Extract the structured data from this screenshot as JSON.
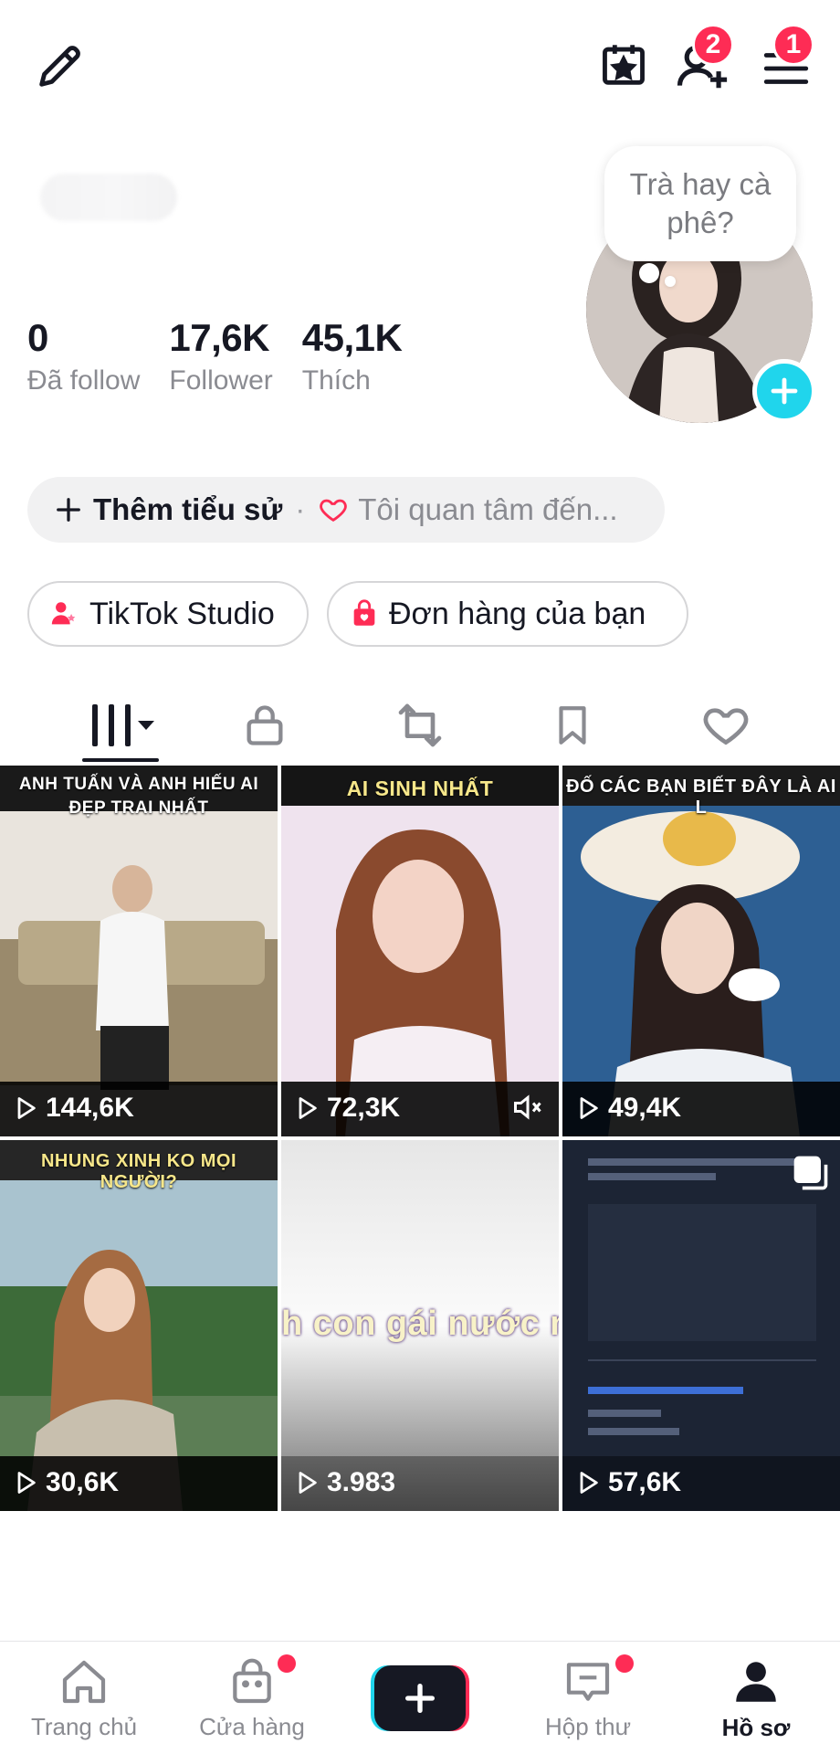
{
  "top_bar": {
    "edit_icon": "pencil-icon",
    "calendar_icon": "calendar-star-icon",
    "add_friend_icon": "add-user-icon",
    "add_friend_badge": "2",
    "menu_icon": "hamburger-menu-icon",
    "menu_badge": "1"
  },
  "profile": {
    "note_bubble": "Trà hay cà phê?",
    "stats": [
      {
        "value": "0",
        "label": "Đã follow"
      },
      {
        "value": "17,6K",
        "label": "Follower"
      },
      {
        "value": "45,1K",
        "label": "Thích"
      }
    ],
    "bio": {
      "add_label": "Thêm tiểu sử",
      "separator": "·",
      "interest_placeholder": "Tôi quan tâm đến..."
    },
    "buttons": {
      "studio": "TikTok Studio",
      "orders": "Đơn hàng của bạn"
    }
  },
  "tabs": [
    {
      "icon": "grid-icon",
      "active": true
    },
    {
      "icon": "lock-icon",
      "active": false
    },
    {
      "icon": "repost-icon",
      "active": false
    },
    {
      "icon": "bookmark-icon",
      "active": false
    },
    {
      "icon": "heart-icon",
      "active": false
    }
  ],
  "videos": [
    {
      "caption": "ANH TUẤN VÀ ANH HIẾU AI ĐẸP TRAI NHẤT",
      "views": "144,6K",
      "muted": false
    },
    {
      "caption": "AI SINH NHẤT",
      "views": "72,3K",
      "muted": true
    },
    {
      "caption": "ĐỐ CÁC BẠN BIẾT ĐÂY LÀ AI L",
      "views": "49,4K",
      "muted": false
    },
    {
      "caption": "NHUNG XINH KO MỌI NGƯỜI?",
      "views": "30,6K",
      "muted": false
    },
    {
      "caption": "h con gái nước n",
      "views": "3.983",
      "muted": false
    },
    {
      "caption": "",
      "views": "57,6K",
      "muted": false,
      "multi": true
    }
  ],
  "bottom_nav": [
    {
      "label": "Trang chủ",
      "icon": "home-icon"
    },
    {
      "label": "Cửa hàng",
      "icon": "shop-bag-icon"
    },
    {
      "label": "",
      "icon": "plus-create-icon"
    },
    {
      "label": "Hộp thư",
      "icon": "inbox-icon"
    },
    {
      "label": "Hồ sơ",
      "icon": "profile-icon"
    }
  ],
  "colors": {
    "accent_red": "#fe2c55",
    "accent_cyan": "#20d5ec",
    "text_primary": "#161823",
    "text_secondary": "#8a8b91"
  }
}
